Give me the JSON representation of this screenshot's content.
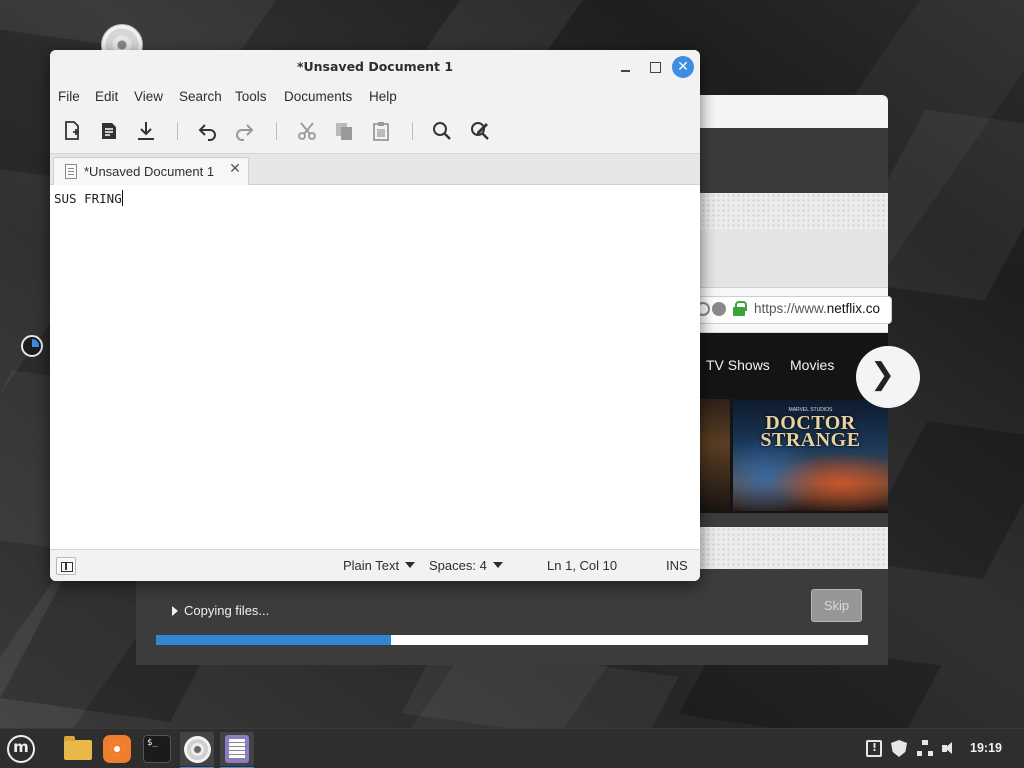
{
  "editor": {
    "title": "*Unsaved Document 1",
    "menu": [
      "File",
      "Edit",
      "View",
      "Search",
      "Tools",
      "Documents",
      "Help"
    ],
    "tab_label": "*Unsaved Document 1",
    "content": "SUS FRING",
    "status": {
      "language": "Plain Text",
      "indent": "Spaces: 4",
      "position": "Ln 1, Col 10",
      "mode": "INS"
    },
    "toolbar_icons": [
      "new-document-icon",
      "open-document-icon",
      "save-icon",
      "undo-icon",
      "redo-icon",
      "cut-icon",
      "copy-icon",
      "paste-icon",
      "search-icon",
      "replace-icon"
    ]
  },
  "installer": {
    "progress_label": "Copying files...",
    "skip_label": "Skip",
    "progress_fraction": 0.33
  },
  "browser": {
    "url_prefix": "https://www.",
    "url_domain": "netflix.co",
    "nav": [
      "TV Shows",
      "Movies"
    ],
    "next_glyph": "❯",
    "poster_tagline": "MARVEL STUDIOS",
    "poster_title_1": "DOCTOR",
    "poster_title_2": "STRANGE"
  },
  "taskbar": {
    "apps": [
      "mint-menu-icon",
      "files-icon",
      "firefox-icon",
      "terminal-icon",
      "disc-icon",
      "text-editor-icon"
    ],
    "terminal_prompt": "$_",
    "clock": "19:19"
  },
  "colors": {
    "accent": "#3d8ee0",
    "progress": "#2f86d2",
    "lock": "#3aa33a"
  }
}
